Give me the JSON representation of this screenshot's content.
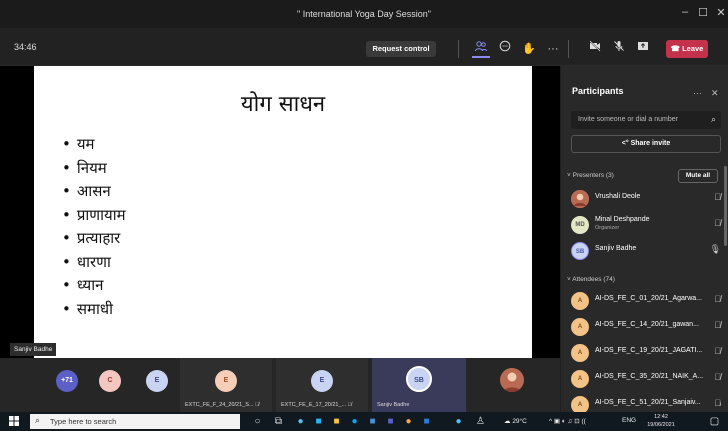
{
  "window": {
    "title": "\" International Yoga Day Session\""
  },
  "toolbar": {
    "timer": "34:46",
    "request_control": "Request control",
    "leave": "Leave"
  },
  "slide": {
    "title": "योग साधन",
    "bullets": [
      "यम",
      "नियम",
      "आसन",
      "प्राणायाम",
      "प्रत्याहार",
      "धारणा",
      "ध्यान",
      "समाधी"
    ]
  },
  "presenter_tag": "Sanjiv Badhe",
  "participants": {
    "title": "Participants",
    "invite_placeholder": "Invite someone or dial a number",
    "share_invite": "Share invite",
    "presenters_header": "Presenters (3)",
    "mute_all": "Mute all",
    "presenters": [
      {
        "name": "Vrushali Deole",
        "sub": "",
        "initials": ""
      },
      {
        "name": "Minal Deshpande",
        "sub": "Organizer",
        "initials": "MD"
      },
      {
        "name": "Sanjiv Badhe",
        "sub": "",
        "initials": "SB"
      }
    ],
    "attendees_header": "Attendees (74)",
    "attendees": [
      {
        "name": "AI-DS_FE_C_01_20/21_Agarwa...",
        "initials": "A"
      },
      {
        "name": "AI-DS_FE_C_14_20/21_gawan...",
        "initials": "A"
      },
      {
        "name": "AI-DS_FE_C_19_20/21_JAGATI...",
        "initials": "A"
      },
      {
        "name": "AI-DS_FE_C_35_20/21_NAIK_A...",
        "initials": "A"
      },
      {
        "name": "AI-DS_FE_C_51_20/21_Sanjaiv...",
        "initials": "A"
      }
    ]
  },
  "strip": {
    "overflow": "+71",
    "avatars": [
      "C",
      "E"
    ],
    "tiles": [
      {
        "initial": "E",
        "name": "EXTC_FE_F_24_20/21_S..."
      },
      {
        "initial": "E",
        "name": "EXTC_FE_E_17_20/21_..."
      },
      {
        "initial": "SB",
        "name": "Sanjiv Badhe"
      }
    ]
  },
  "taskbar": {
    "search_placeholder": "Type here to search",
    "weather": "29°C",
    "lang": "ENG",
    "time": "12:42",
    "date": "19/06/2021"
  }
}
